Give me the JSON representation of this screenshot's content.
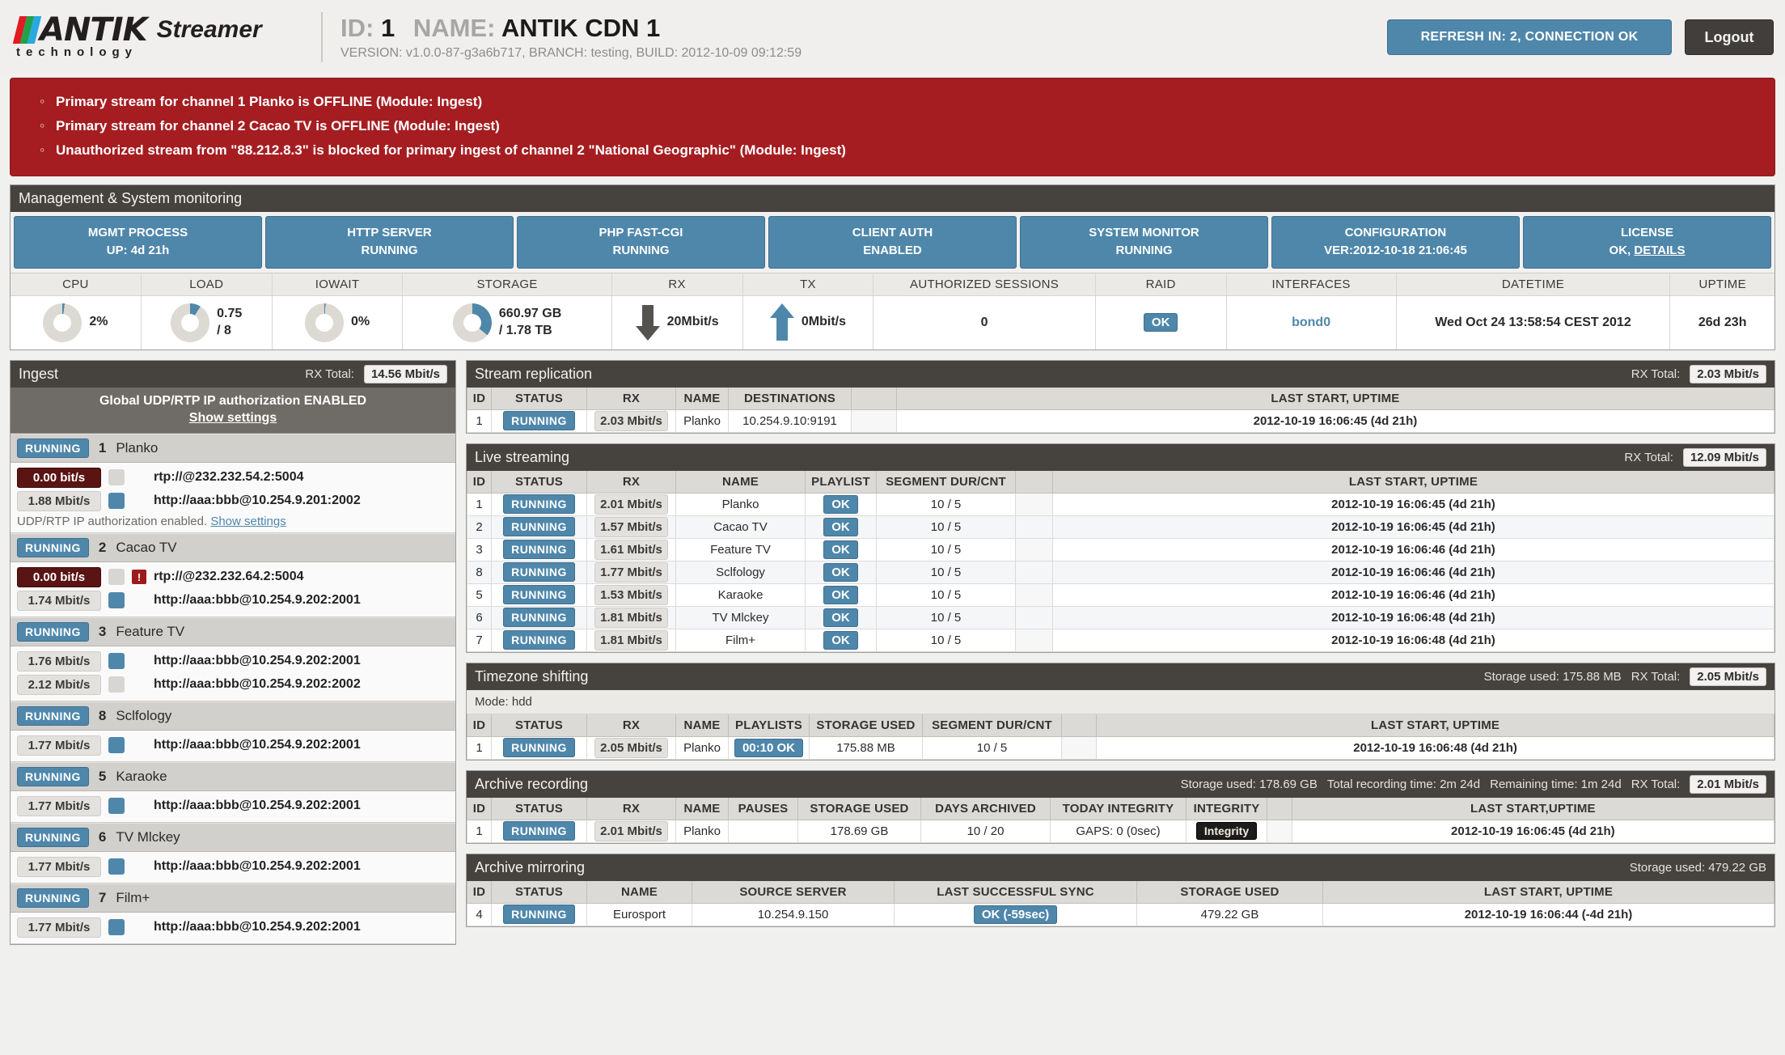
{
  "header": {
    "logo_antik": "ANTIK",
    "logo_streamer": "Streamer",
    "logo_tech": "technology",
    "id_label": "ID:",
    "id_value": "1",
    "name_label": "NAME:",
    "name_value": "ANTIK CDN 1",
    "version_line": "VERSION: v1.0.0-87-g3a6b717, BRANCH: testing, BUILD: 2012-10-09 09:12:59",
    "refresh_button": "REFRESH IN: 2, CONNECTION OK",
    "logout_button": "Logout"
  },
  "alerts": [
    "Primary stream for channel 1 Planko  is OFFLINE (Module: Ingest)",
    "Primary stream for channel 2 Cacao TV  is OFFLINE (Module: Ingest)",
    "Unauthorized stream from \"88.212.8.3\" is blocked for primary ingest of channel 2 \"National Geographic\" (Module: Ingest)"
  ],
  "mgmt": {
    "title": "Management & System monitoring",
    "boxes": [
      {
        "l1": "MGMT PROCESS",
        "l2": "UP: 4d 21h"
      },
      {
        "l1": "HTTP SERVER",
        "l2": "RUNNING"
      },
      {
        "l1": "PHP FAST-CGI",
        "l2": "RUNNING"
      },
      {
        "l1": "CLIENT AUTH",
        "l2": "ENABLED"
      },
      {
        "l1": "SYSTEM MONITOR",
        "l2": "RUNNING"
      },
      {
        "l1": "CONFIGURATION",
        "l2": "VER:2012-10-18 21:06:45"
      },
      {
        "l1": "LICENSE",
        "l2": "OK, DETAILS"
      }
    ],
    "metrics": {
      "cpu": {
        "head": "CPU",
        "value": "2%",
        "pct": 2
      },
      "load": {
        "head": "LOAD",
        "value_1": "0.75",
        "value_2": "/ 8",
        "pct": 9
      },
      "iowait": {
        "head": "IOWAIT",
        "value": "0%",
        "pct": 0
      },
      "storage": {
        "head": "STORAGE",
        "value_1": "660.97 GB",
        "value_2": "/ 1.78 TB",
        "pct": 36
      },
      "rx": {
        "head": "RX",
        "value": "20Mbit/s"
      },
      "tx": {
        "head": "TX",
        "value": "0Mbit/s"
      },
      "sessions": {
        "head": "AUTHORIZED SESSIONS",
        "value": "0"
      },
      "raid": {
        "head": "RAID",
        "value": "OK"
      },
      "interfaces": {
        "head": "INTERFACES",
        "value": "bond0"
      },
      "datetime": {
        "head": "DATETIME",
        "value": "Wed Oct 24 13:58:54 CEST 2012"
      },
      "uptime": {
        "head": "UPTIME",
        "value": "26d 23h"
      }
    }
  },
  "ingest": {
    "title": "Ingest",
    "rx_total_label": "RX Total:",
    "rx_total": "14.56 Mbit/s",
    "global_auth": "Global UDP/RTP IP authorization ENABLED",
    "global_auth_link": "Show settings",
    "channels": [
      {
        "status": "RUNNING",
        "num": "1",
        "name": "Planko",
        "sources": [
          {
            "rate": "0.00 bit/s",
            "zero": true,
            "sq_on": false,
            "warn": false,
            "url": "rtp://@232.232.54.2:5004"
          },
          {
            "rate": "1.88 Mbit/s",
            "zero": false,
            "sq_on": true,
            "warn": false,
            "url": "http://aaa:bbb@10.254.9.201:2002"
          }
        ],
        "note": "UDP/RTP IP authorization enabled.",
        "note_link": "Show settings"
      },
      {
        "status": "RUNNING",
        "num": "2",
        "name": "Cacao TV",
        "sources": [
          {
            "rate": "0.00 bit/s",
            "zero": true,
            "sq_on": false,
            "warn": true,
            "url": "rtp://@232.232.64.2:5004"
          },
          {
            "rate": "1.74 Mbit/s",
            "zero": false,
            "sq_on": true,
            "warn": false,
            "url": "http://aaa:bbb@10.254.9.202:2001"
          }
        ]
      },
      {
        "status": "RUNNING",
        "num": "3",
        "name": "Feature TV",
        "sources": [
          {
            "rate": "1.76 Mbit/s",
            "zero": false,
            "sq_on": true,
            "warn": false,
            "url": "http://aaa:bbb@10.254.9.202:2001"
          },
          {
            "rate": "2.12 Mbit/s",
            "zero": false,
            "sq_on": false,
            "warn": false,
            "url": "http://aaa:bbb@10.254.9.202:2002"
          }
        ]
      },
      {
        "status": "RUNNING",
        "num": "8",
        "name": "Sclfology",
        "sources": [
          {
            "rate": "1.77 Mbit/s",
            "zero": false,
            "sq_on": true,
            "warn": false,
            "url": "http://aaa:bbb@10.254.9.202:2001"
          }
        ]
      },
      {
        "status": "RUNNING",
        "num": "5",
        "name": "Karaoke",
        "sources": [
          {
            "rate": "1.77 Mbit/s",
            "zero": false,
            "sq_on": true,
            "warn": false,
            "url": "http://aaa:bbb@10.254.9.202:2001"
          }
        ]
      },
      {
        "status": "RUNNING",
        "num": "6",
        "name": "TV Mlckey",
        "sources": [
          {
            "rate": "1.77 Mbit/s",
            "zero": false,
            "sq_on": true,
            "warn": false,
            "url": "http://aaa:bbb@10.254.9.202:2001"
          }
        ]
      },
      {
        "status": "RUNNING",
        "num": "7",
        "name": "Film+",
        "sources": [
          {
            "rate": "1.77 Mbit/s",
            "zero": false,
            "sq_on": true,
            "warn": false,
            "url": "http://aaa:bbb@10.254.9.202:2001"
          }
        ]
      }
    ]
  },
  "stream_replication": {
    "title": "Stream replication",
    "rx_total_label": "RX Total:",
    "rx_total": "2.03 Mbit/s",
    "columns": [
      "ID",
      "STATUS",
      "RX",
      "NAME",
      "DESTINATIONS",
      "",
      "LAST START, UPTIME"
    ],
    "rows": [
      {
        "id": "1",
        "status": "RUNNING",
        "rx": "2.03 Mbit/s",
        "name": "Planko",
        "destinations": "10.254.9.10:9191",
        "filler": "",
        "last_start": "2012-10-19 16:06:45 (4d 21h)"
      }
    ]
  },
  "live_streaming": {
    "title": "Live streaming",
    "rx_total_label": "RX Total:",
    "rx_total": "12.09 Mbit/s",
    "columns": [
      "ID",
      "STATUS",
      "RX",
      "NAME",
      "PLAYLIST",
      "SEGMENT DUR/CNT",
      "",
      "LAST START, UPTIME"
    ],
    "rows": [
      {
        "id": "1",
        "status": "RUNNING",
        "rx": "2.01 Mbit/s",
        "name": "Planko",
        "playlist": "OK",
        "segment": "10 / 5",
        "last_start": "2012-10-19 16:06:45 (4d 21h)"
      },
      {
        "id": "2",
        "status": "RUNNING",
        "rx": "1.57 Mbit/s",
        "name": "Cacao TV",
        "playlist": "OK",
        "segment": "10 / 5",
        "last_start": "2012-10-19 16:06:45 (4d 21h)"
      },
      {
        "id": "3",
        "status": "RUNNING",
        "rx": "1.61 Mbit/s",
        "name": "Feature TV",
        "playlist": "OK",
        "segment": "10 / 5",
        "last_start": "2012-10-19 16:06:46 (4d 21h)"
      },
      {
        "id": "8",
        "status": "RUNNING",
        "rx": "1.77 Mbit/s",
        "name": "Sclfology",
        "playlist": "OK",
        "segment": "10 / 5",
        "last_start": "2012-10-19 16:06:46 (4d 21h)"
      },
      {
        "id": "5",
        "status": "RUNNING",
        "rx": "1.53 Mbit/s",
        "name": "Karaoke",
        "playlist": "OK",
        "segment": "10 / 5",
        "last_start": "2012-10-19 16:06:46 (4d 21h)"
      },
      {
        "id": "6",
        "status": "RUNNING",
        "rx": "1.81 Mbit/s",
        "name": "TV Mlckey",
        "playlist": "OK",
        "segment": "10 / 5",
        "last_start": "2012-10-19 16:06:48 (4d 21h)"
      },
      {
        "id": "7",
        "status": "RUNNING",
        "rx": "1.81 Mbit/s",
        "name": "Film+",
        "playlist": "OK",
        "segment": "10 / 5",
        "last_start": "2012-10-19 16:06:48 (4d 21h)"
      }
    ]
  },
  "timezone_shifting": {
    "title": "Timezone shifting",
    "storage_used_label": "Storage used: 175.88 MB",
    "rx_total_label": "RX Total:",
    "rx_total": "2.05 Mbit/s",
    "mode": "Mode: hdd",
    "columns": [
      "ID",
      "STATUS",
      "RX",
      "NAME",
      "PLAYLISTS",
      "STORAGE USED",
      "SEGMENT DUR/CNT",
      "",
      "LAST START, UPTIME"
    ],
    "rows": [
      {
        "id": "1",
        "status": "RUNNING",
        "rx": "2.05 Mbit/s",
        "name": "Planko",
        "playlists": "00:10 OK",
        "storage_used": "175.88 MB",
        "segment": "10 / 5",
        "last_start": "2012-10-19 16:06:48 (4d 21h)"
      }
    ]
  },
  "archive_recording": {
    "title": "Archive recording",
    "storage_used_label": "Storage used: 178.69 GB",
    "total_time_label": "Total recording time: 2m 24d",
    "remaining_label": "Remaining time: 1m 24d",
    "rx_total_label": "RX Total:",
    "rx_total": "2.01 Mbit/s",
    "columns": [
      "ID",
      "STATUS",
      "RX",
      "NAME",
      "PAUSES",
      "STORAGE USED",
      "DAYS ARCHIVED",
      "TODAY INTEGRITY",
      "INTEGRITY",
      "",
      "LAST START,UPTIME"
    ],
    "rows": [
      {
        "id": "1",
        "status": "RUNNING",
        "rx": "2.01 Mbit/s",
        "name": "Planko",
        "pauses": "",
        "storage_used": "178.69 GB",
        "days_archived": "10 / 20",
        "today_integrity": "GAPS: 0 (0sec)",
        "integrity": "Integrity",
        "last_start": "2012-10-19 16:06:45 (4d 21h)"
      }
    ]
  },
  "archive_mirroring": {
    "title": "Archive mirroring",
    "storage_used_label": "Storage used: 479.22 GB",
    "columns": [
      "ID",
      "STATUS",
      "NAME",
      "SOURCE SERVER",
      "LAST SUCCESSFUL SYNC",
      "STORAGE USED",
      "LAST START, UPTIME"
    ],
    "rows": [
      {
        "id": "4",
        "status": "RUNNING",
        "name": "Eurosport",
        "source_server": "10.254.9.150",
        "last_sync": "OK (-59sec)",
        "storage_used": "479.22 GB",
        "last_start": "2012-10-19 16:06:44 (-4d 21h)"
      }
    ]
  }
}
